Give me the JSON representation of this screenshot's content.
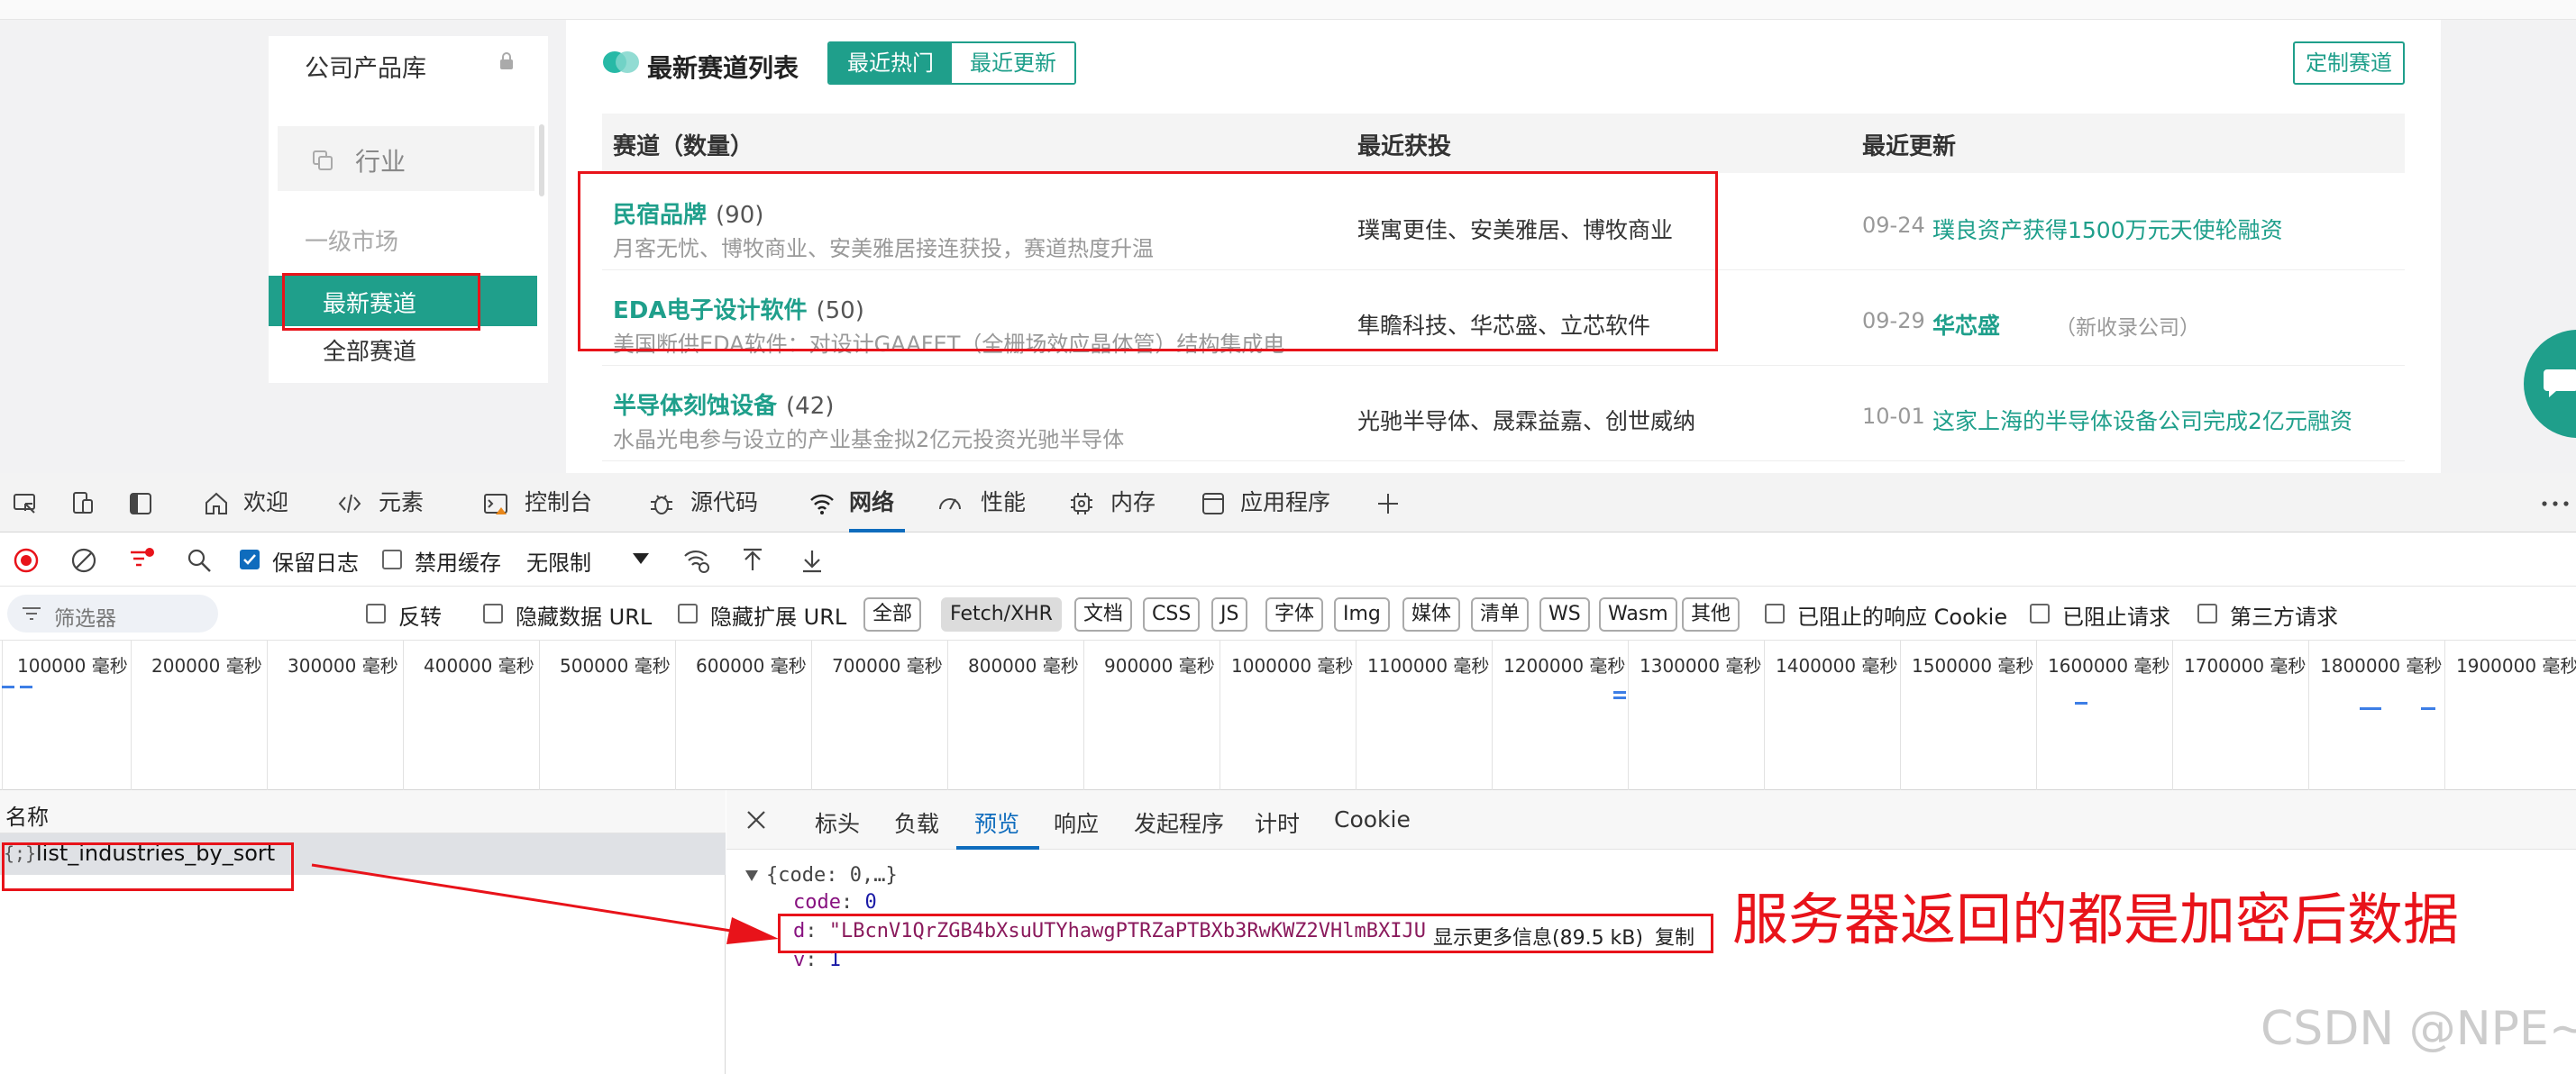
{
  "web": {
    "left_panel": {
      "title": "公司产品库",
      "industry_label": "行业",
      "market_label": "一级市场",
      "latest_track": "最新赛道",
      "all_track": "全部赛道"
    },
    "main": {
      "title": "最新赛道列表",
      "tabs": [
        "最近热门",
        "最近更新"
      ],
      "custom_button": "定制赛道",
      "columns": [
        "赛道（数量）",
        "最近获投",
        "最近更新"
      ],
      "rows": [
        {
          "name": "民宿品牌",
          "count": "(90)",
          "desc": "月客无忧、博牧商业、安美雅居接连获投，赛道热度升温",
          "investors": "璞寓更佳、安美雅居、博牧商业",
          "date": "09-24",
          "news": "璞良资产获得1500万元天使轮融资",
          "note": ""
        },
        {
          "name": "EDA电子设计软件",
          "count": "(50)",
          "desc": "美国断供EDA软件：对设计GAAFET（全栅场效应晶体管）结构集成电路所必须的EDA软件实施出口管制",
          "investors": "隼瞻科技、华芯盛、立芯软件",
          "date": "09-29",
          "news": "华芯盛",
          "note": "（新收录公司）"
        },
        {
          "name": "半导体刻蚀设备",
          "count": "(42)",
          "desc": "水晶光电参与设立的产业基金拟2亿元投资光驰半导体",
          "investors": "光驰半导体、晟霖益嘉、创世威纳",
          "date": "10-01",
          "news": "这家上海的半导体设备公司完成2亿元融资",
          "note": ""
        }
      ]
    }
  },
  "devtools": {
    "tabs": [
      "欢迎",
      "元素",
      "控制台",
      "源代码",
      "网络",
      "性能",
      "内存",
      "应用程序"
    ],
    "toolbar": {
      "preserve_log": "保留日志",
      "disable_cache": "禁用缓存",
      "throttle": "无限制"
    },
    "filter": {
      "placeholder": "筛选器",
      "invert": "反转",
      "hide_data_url": "隐藏数据 URL",
      "hide_ext_url": "隐藏扩展 URL",
      "chips": [
        "全部",
        "Fetch/XHR",
        "文档",
        "CSS",
        "JS",
        "字体",
        "Img",
        "媒体",
        "清单",
        "WS",
        "Wasm",
        "其他"
      ],
      "blocked_cookie": "已阻止的响应 Cookie",
      "blocked_requests": "已阻止请求",
      "third_party": "第三方请求"
    },
    "timeline_ticks": [
      "100000 毫秒",
      "200000 毫秒",
      "300000 毫秒",
      "400000 毫秒",
      "500000 毫秒",
      "600000 毫秒",
      "700000 毫秒",
      "800000 毫秒",
      "900000 毫秒",
      "1000000 毫秒",
      "1100000 毫秒",
      "1200000 毫秒",
      "1300000 毫秒",
      "1400000 毫秒",
      "1500000 毫秒",
      "1600000 毫秒",
      "1700000 毫秒",
      "1800000 毫秒",
      "1900000 毫秒"
    ],
    "list": {
      "header": "名称",
      "row_icon": "{;}",
      "row_name": "list_industries_by_sort"
    },
    "detail_tabs": [
      "标头",
      "负载",
      "预览",
      "响应",
      "发起程序",
      "计时",
      "Cookie"
    ],
    "preview": {
      "root": "{code: 0,…}",
      "code_key": "code",
      "code_val": "0",
      "d_key": "d",
      "d_val": "\"LBcnV1QrZGB4bXsuUTYhawgPTRZaPTBXb3RwKWZ2VHlmBXIJU",
      "show_more": "显示更多信息(89.5 kB)",
      "copy": "复制",
      "v_key": "v",
      "v_val": "1"
    }
  },
  "annotation": "服务器返回的都是加密后数据",
  "watermark": "CSDN @NPE~",
  "colors": {
    "accent": "#1f9f8b",
    "red": "#e8131a",
    "devtools_blue": "#0f6cbd"
  }
}
